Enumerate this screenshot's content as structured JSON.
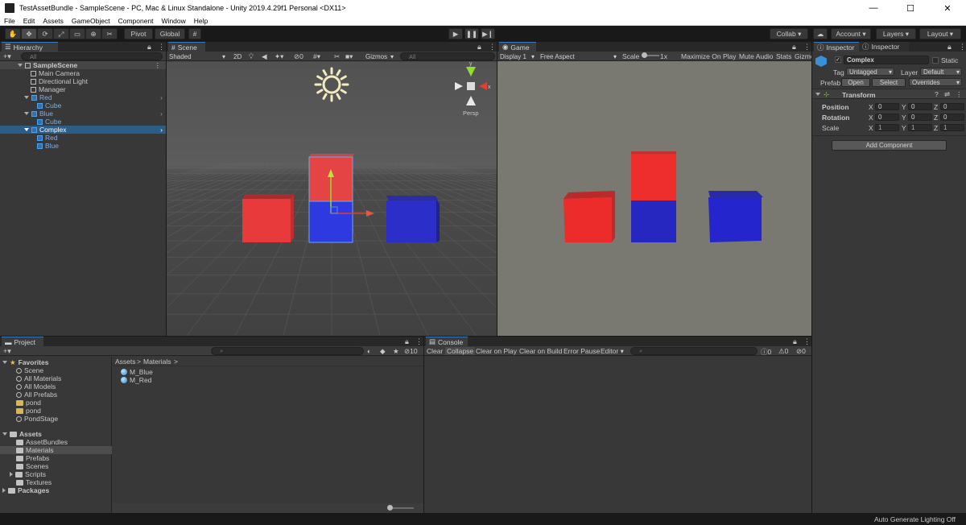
{
  "window": {
    "title": "TestAssetBundle - SampleScene - PC, Mac & Linux Standalone - Unity 2019.4.29f1 Personal <DX11>",
    "minimize": "—",
    "maximize": "☐",
    "close": "✕"
  },
  "menu": [
    "File",
    "Edit",
    "Assets",
    "GameObject",
    "Component",
    "Window",
    "Help"
  ],
  "toolbar": {
    "pivot": "Pivot",
    "global": "Global",
    "collab": "Collab ▾",
    "account": "Account",
    "layers": "Layers",
    "layout": "Layout"
  },
  "hierarchy": {
    "tab": "Hierarchy",
    "add": "+▾",
    "search_placeholder": "All",
    "items": [
      {
        "label": "SampleScene",
        "indent": 0
      },
      {
        "label": "Main Camera",
        "indent": 1
      },
      {
        "label": "Directional Light",
        "indent": 1
      },
      {
        "label": "Manager",
        "indent": 1
      },
      {
        "label": "Red",
        "indent": 1
      },
      {
        "label": "Cube",
        "indent": 2
      },
      {
        "label": "Blue",
        "indent": 1
      },
      {
        "label": "Cube",
        "indent": 2
      },
      {
        "label": "Complex",
        "indent": 1
      },
      {
        "label": "Red",
        "indent": 2
      },
      {
        "label": "Blue",
        "indent": 2
      }
    ]
  },
  "scene": {
    "tab": "Scene",
    "shading": "Shaded",
    "mode2d": "2D",
    "hidden_count": "0",
    "gizmos": "Gizmos",
    "search_placeholder": "All",
    "axis_y": "y",
    "axis_x": "x",
    "persp": "Persp"
  },
  "game": {
    "tab": "Game",
    "display": "Display 1",
    "aspect": "Free Aspect",
    "scale_label": "Scale",
    "scale_value": "1x",
    "maximize_on_play": "Maximize On Play",
    "mute_audio": "Mute Audio",
    "stats": "Stats",
    "gizmos": "Gizmo"
  },
  "inspector": {
    "tab1": "Inspector",
    "tab2": "Inspector",
    "object_name": "Complex",
    "static": "Static",
    "tag_label": "Tag",
    "tag_value": "Untagged",
    "layer_label": "Layer",
    "layer_value": "Default",
    "prefab_label": "Prefab",
    "open": "Open",
    "select": "Select",
    "overrides": "Overrides",
    "transform": "Transform",
    "position": "Position",
    "rotation": "Rotation",
    "scale": "Scale",
    "x": "X",
    "y": "Y",
    "z": "Z",
    "pos": [
      "0",
      "0",
      "0"
    ],
    "rot": [
      "0",
      "0",
      "0"
    ],
    "scl": [
      "1",
      "1",
      "1"
    ],
    "add_component": "Add Component"
  },
  "project": {
    "tab": "Project",
    "add": "+▾",
    "hidden_count": "10",
    "favorites": "Favorites",
    "favorite_items": [
      "Scene",
      "All Materials",
      "All Models",
      "All Prefabs",
      "pond",
      "pond",
      "PondStage"
    ],
    "assets": "Assets",
    "asset_folders": [
      "AssetBundles",
      "Materials",
      "Prefabs",
      "Scenes",
      "Scripts",
      "Textures"
    ],
    "packages": "Packages",
    "breadcrumb_root": "Assets",
    "breadcrumb_sep": ">",
    "breadcrumb_leaf": "Materials",
    "files": [
      "M_Blue",
      "M_Red"
    ]
  },
  "console": {
    "tab": "Console",
    "clear": "Clear",
    "collapse": "Collapse",
    "clear_on_play": "Clear on Play",
    "clear_on_build": "Clear on Build",
    "error_pause": "Error Pause",
    "editor": "Editor ▾",
    "count_info": "0",
    "count_warn": "0",
    "count_err": "0"
  },
  "status": {
    "text": "Auto Generate Lighting Off"
  },
  "colors": {
    "red": "#e83a3a",
    "blue": "#2c2ec9",
    "selection": "#2c5d87"
  }
}
